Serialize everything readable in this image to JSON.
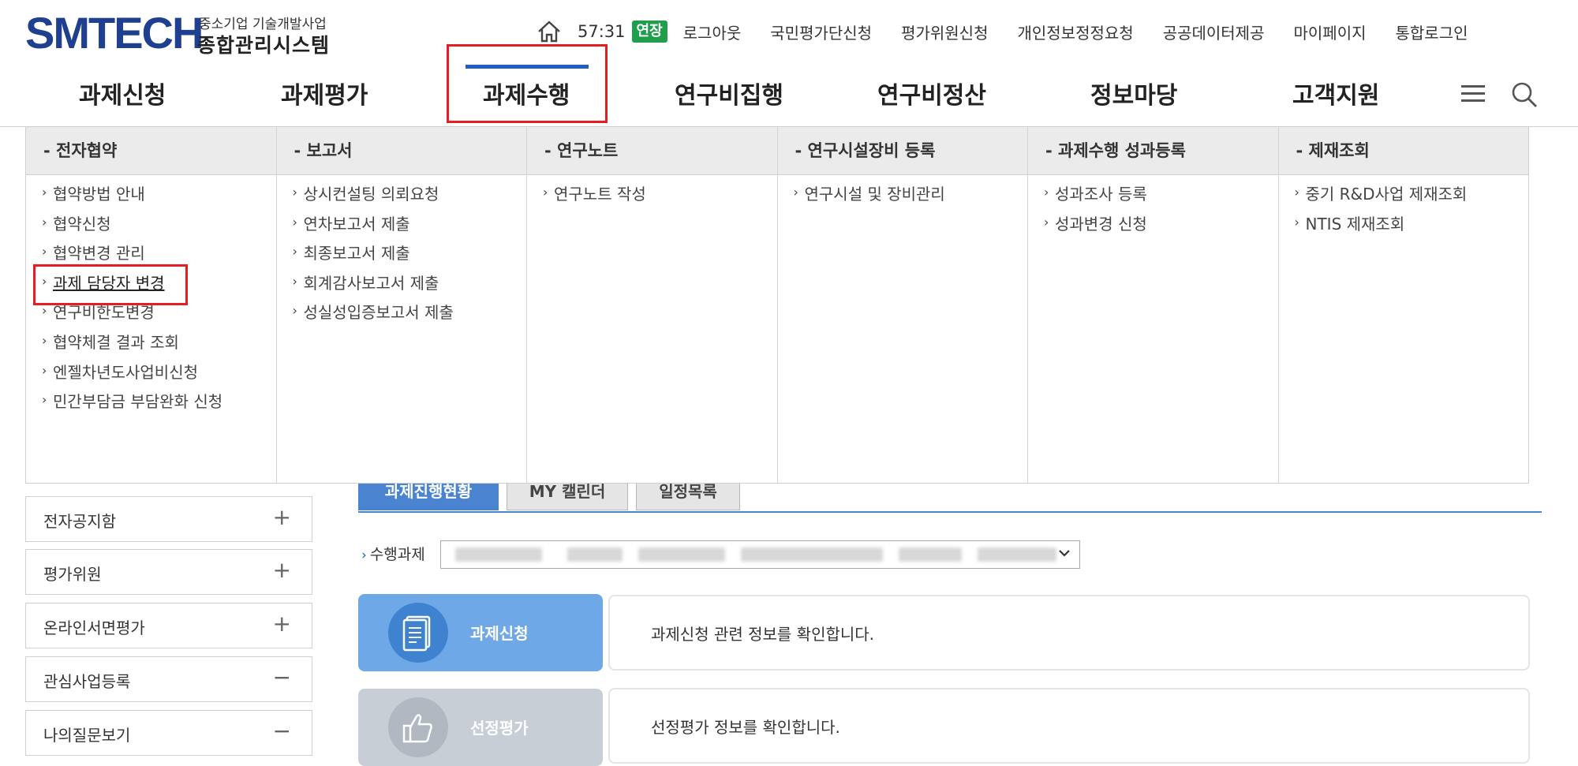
{
  "header": {
    "logo_main": "SMTECH",
    "logo_sub1": "중소기업 기술개발사업",
    "logo_sub2": "종합관리시스템",
    "timer": "57:31",
    "extend_label": "연장",
    "util_links": [
      "로그아웃",
      "국민평가단신청",
      "평가위원신청",
      "개인정보정정요청",
      "공공데이터제공",
      "마이페이지",
      "통합로그인"
    ]
  },
  "gnb": {
    "items": [
      "과제신청",
      "과제평가",
      "과제수행",
      "연구비집행",
      "연구비정산",
      "정보마당",
      "고객지원"
    ],
    "active": "과제수행"
  },
  "mega_menu": {
    "columns": [
      {
        "title": "- 전자협약",
        "items": [
          "협약방법 안내",
          "협약신청",
          "협약변경 관리",
          "과제 담당자 변경",
          "연구비한도변경",
          "협약체결 결과 조회",
          "엔젤차년도사업비신청",
          "민간부담금 부담완화 신청"
        ]
      },
      {
        "title": "- 보고서",
        "items": [
          "상시컨설팅 의뢰요청",
          "연차보고서 제출",
          "최종보고서 제출",
          "회계감사보고서 제출",
          "성실성입증보고서 제출"
        ]
      },
      {
        "title": "- 연구노트",
        "items": [
          "연구노트 작성"
        ]
      },
      {
        "title": "- 연구시설장비 등록",
        "items": [
          "연구시설 및 장비관리"
        ]
      },
      {
        "title": "- 과제수행 성과등록",
        "items": [
          "성과조사 등록",
          "성과변경 신청"
        ]
      },
      {
        "title": "- 제재조회",
        "items": [
          "중기 R&D사업 제재조회",
          "NTIS 제재조회"
        ]
      }
    ],
    "highlighted_item": "과제 담당자 변경"
  },
  "sidebar": {
    "items": [
      {
        "label": "전자공지함",
        "sign": "+"
      },
      {
        "label": "평가위원",
        "sign": "+"
      },
      {
        "label": "온라인서면평가",
        "sign": "+"
      },
      {
        "label": "관심사업등록",
        "sign": "−"
      },
      {
        "label": "나의질문보기",
        "sign": "−"
      }
    ]
  },
  "content": {
    "tabs": [
      "과제진행현황",
      "MY 캘린더",
      "일정목록"
    ],
    "active_tab": "과제진행현황",
    "field_label": "수행과제",
    "cards": [
      {
        "label": "과제신청",
        "desc": "과제신청 관련 정보를 확인합니다."
      },
      {
        "label": "선정평가",
        "desc": "선정평가 정보를 확인합니다."
      }
    ]
  },
  "colors": {
    "brand": "#1f3f8f",
    "accent": "#1f5fbf",
    "highlight": "#e61e24",
    "extend": "#1f9e4c"
  }
}
